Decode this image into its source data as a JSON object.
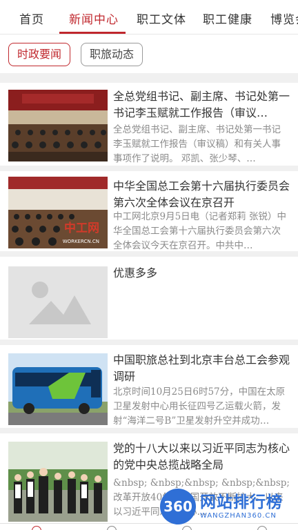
{
  "tabs": [
    {
      "label": "首页"
    },
    {
      "label": "新闻中心"
    },
    {
      "label": "职工文体"
    },
    {
      "label": "职工健康"
    },
    {
      "label": "博览会"
    }
  ],
  "subtabs": [
    {
      "label": "时政要闻"
    },
    {
      "label": "职旅动态"
    }
  ],
  "news": [
    {
      "title": "全总党组书记、副主席、书记处第一书记李玉赋就工作报告（审议…",
      "summary": "全总党组书记、副主席、书记处第一书记李玉赋就工作报告（审议稿）和有关人事事项作了说明。 邓凯、张少琴、…"
    },
    {
      "title": "中华全国总工会第十六届执行委员会第六次全体会议在京召开",
      "summary": "中工网北京9月5日电（记者郑莉 张锐）中华全国总工会第十六届执行委员会第六次全体会议今天在京召开。中共中…",
      "image_caption": "中工网",
      "image_url_text": "WORKERCN.CN"
    },
    {
      "title": "优惠多多",
      "summary": ""
    },
    {
      "title": "中国职旅总社到北京丰台总工会参观调研",
      "summary": "北京时间10月25日6时57分，中国在太原卫星发射中心用长征四号乙运载火箭，发射“海洋二号B”卫星发射升空并成功…"
    },
    {
      "title": "党的十八大以来以习近平同志为核心的党中央总揽战略全局",
      "summary": "&nbsp; &nbsp;&nbsp; &nbsp;&nbsp; 改革开放40年，中国开放不断扩大。以来以习近平同志为核心…"
    }
  ],
  "watermark": {
    "badge": "360",
    "text": "网站排行榜",
    "sub": "WANGZHAN360.CN"
  },
  "colors": {
    "accent": "#c0272d",
    "divider": "#f0f0f0",
    "watermark": "#2f6fd6"
  }
}
